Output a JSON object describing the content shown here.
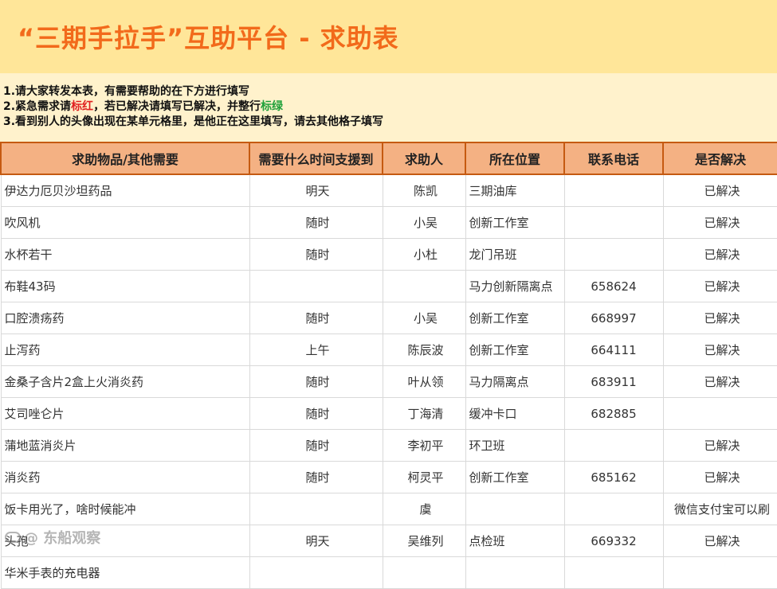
{
  "title": "“三期手拉手”互助平台 - 求助表",
  "notes": {
    "line1": "1.请大家转发本表，有需要帮助的在下方进行填写",
    "line2_a": "2.紧急需求请",
    "line2_red": "标红",
    "line2_b": "，若已解决请填写已解决，并整行",
    "line2_green": "标绿",
    "line3": "3.看到别人的头像出现在某单元格里，是他正在这里填写，请去其他格子填写",
    "red_color": "#E02020",
    "green_color": "#1FA03A"
  },
  "colors": {
    "title_bg": "#FFE699",
    "title_text": "#F26A1B",
    "notes_bg": "#FFF2CC",
    "header_bg": "#F4B183",
    "header_border": "#C55A11"
  },
  "table": {
    "headers": [
      "求助物品/其他需要",
      "需要什么时间支援到",
      "求助人",
      "所在位置",
      "联系电话",
      "是否解决"
    ],
    "rows": [
      [
        "伊达力厄贝沙坦药品",
        "明天",
        "陈凯",
        "三期油库",
        "",
        "已解决"
      ],
      [
        "吹风机",
        "随时",
        "小吴",
        "创新工作室",
        "",
        "已解决"
      ],
      [
        "水杯若干",
        "随时",
        "小杜",
        "龙门吊班",
        "",
        "已解决"
      ],
      [
        "布鞋43码",
        "",
        "",
        "马力创新隔离点",
        "658624",
        "已解决"
      ],
      [
        "口腔溃疡药",
        "随时",
        "小吴",
        "创新工作室",
        "668997",
        "已解决"
      ],
      [
        "止泻药",
        "上午",
        "陈辰波",
        "创新工作室",
        "664111",
        "已解决"
      ],
      [
        "金桑子含片2盒上火消炎药",
        "随时",
        "叶从领",
        "马力隔离点",
        "683911",
        "已解决"
      ],
      [
        "艾司唑仑片",
        "随时",
        "丁海清",
        "缓冲卡口",
        "682885",
        ""
      ],
      [
        "蒲地蓝消炎片",
        "随时",
        "李初平",
        "环卫班",
        "",
        "已解决"
      ],
      [
        "消炎药",
        "随时",
        "柯灵平",
        "创新工作室",
        "685162",
        "已解决"
      ],
      [
        "饭卡用光了，啥时候能冲",
        "",
        "虞",
        "",
        "",
        "微信支付宝可以刷"
      ],
      [
        "头孢",
        "明天",
        "吴维列",
        "点检班",
        "669332",
        "已解决"
      ],
      [
        "华米手表的充电器",
        "",
        "",
        "",
        "",
        ""
      ]
    ]
  },
  "watermark": {
    "text": "@ 东船观察"
  }
}
